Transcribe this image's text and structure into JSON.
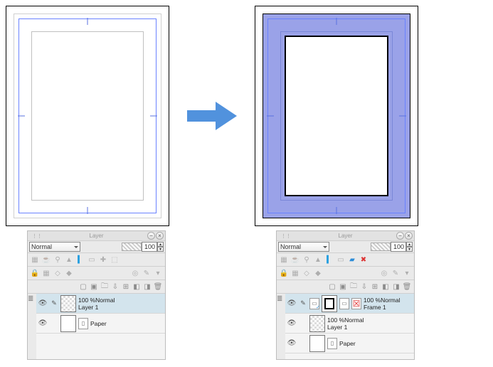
{
  "panel_title": "Layer",
  "blend_mode": "Normal",
  "opacity_value": "100",
  "left": {
    "layers": [
      {
        "opacity": "100 %Normal",
        "name": "Layer 1"
      },
      {
        "opacity": "",
        "name": "Paper"
      }
    ]
  },
  "right": {
    "layers": [
      {
        "opacity": "100 %Normal",
        "name": "Frame 1"
      },
      {
        "opacity": "100 %Normal",
        "name": "Layer 1"
      },
      {
        "opacity": "",
        "name": "Paper"
      }
    ]
  },
  "icons": {
    "minimize": "−",
    "close": "×",
    "lock": "🔒",
    "wand": "✎",
    "ruler": "📐",
    "pin": "📌",
    "mask": "◧",
    "stack": "≣",
    "newlayer": "▢",
    "newfolder": "🗀",
    "copy": "⎘",
    "transfer": "⇄",
    "combine": "⊞",
    "delete": "🗑",
    "eye": "👁",
    "pen": "✎",
    "frame": "▭",
    "page": "▯"
  }
}
